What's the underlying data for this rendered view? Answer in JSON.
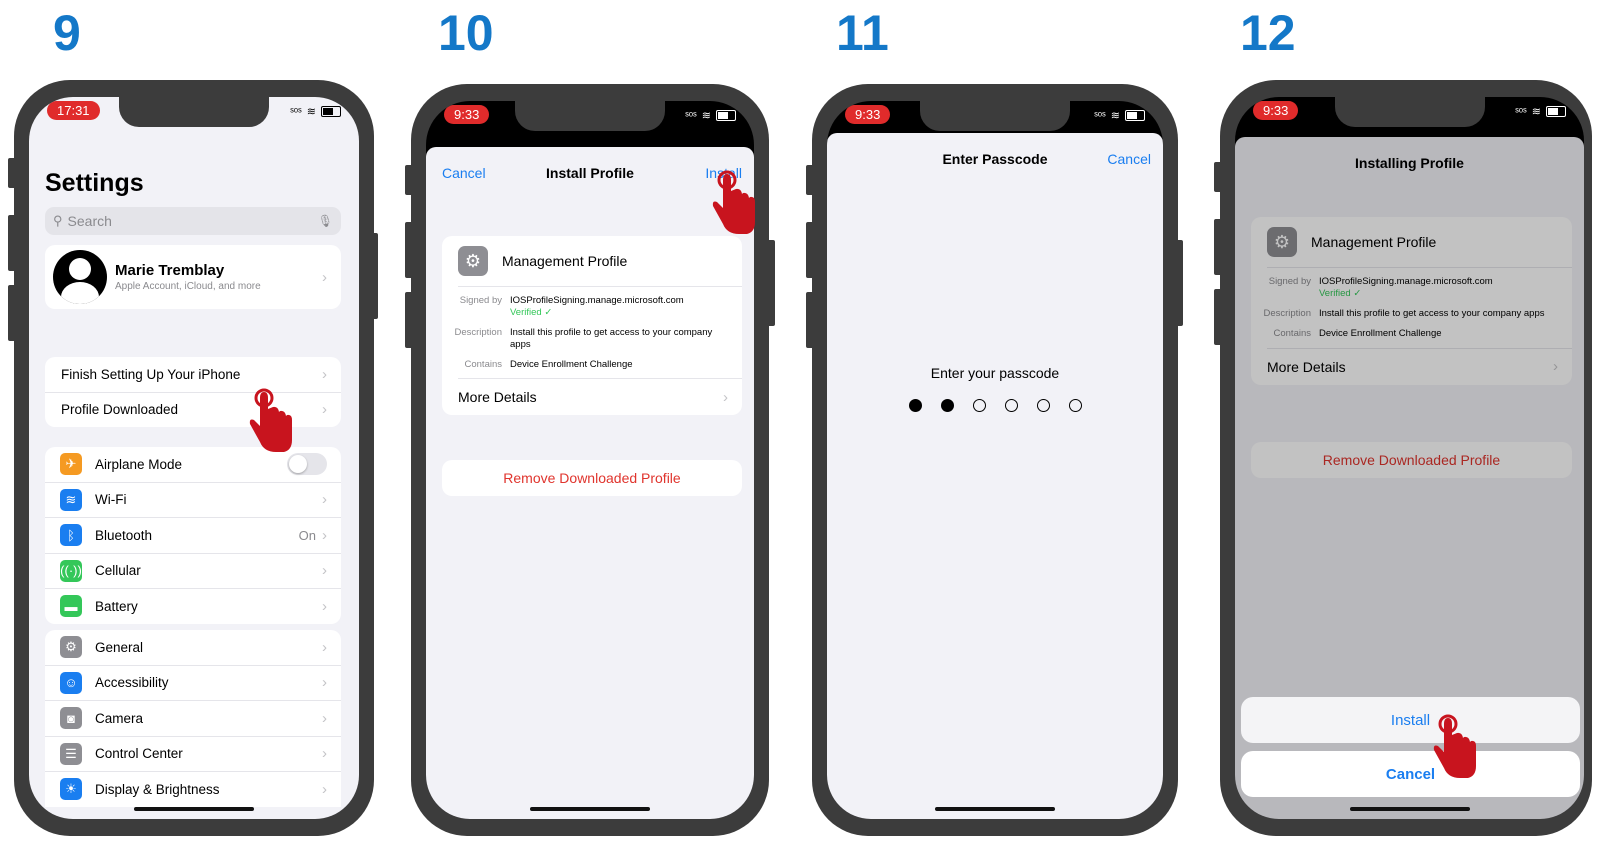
{
  "steps": [
    "9",
    "10",
    "11",
    "12"
  ],
  "accent_color": "#1478c8",
  "phone1": {
    "time": "17:31",
    "title": "Settings",
    "search_placeholder": "Search",
    "profile": {
      "name": "Marie Tremblay",
      "subtitle": "Apple Account, iCloud, and more"
    },
    "group1": [
      "Finish Setting Up Your iPhone",
      "Profile Downloaded"
    ],
    "group2": [
      {
        "label": "Airplane Mode",
        "icon": "airplane-icon",
        "color": "#f59a22"
      },
      {
        "label": "Wi-Fi",
        "icon": "wifi-icon",
        "color": "#1a7ef0"
      },
      {
        "label": "Bluetooth",
        "icon": "bluetooth-icon",
        "color": "#1a7ef0",
        "value": "On"
      },
      {
        "label": "Cellular",
        "icon": "cellular-icon",
        "color": "#34c759"
      },
      {
        "label": "Battery",
        "icon": "battery-icon",
        "color": "#34c759"
      }
    ],
    "group3": [
      {
        "label": "General",
        "icon": "gear-icon",
        "color": "#8e8e93"
      },
      {
        "label": "Accessibility",
        "icon": "accessibility-icon",
        "color": "#1a7ef0"
      },
      {
        "label": "Camera",
        "icon": "camera-icon",
        "color": "#8e8e93"
      },
      {
        "label": "Control Center",
        "icon": "control-center-icon",
        "color": "#8e8e93"
      },
      {
        "label": "Display & Brightness",
        "icon": "brightness-icon",
        "color": "#1a7ef0"
      }
    ]
  },
  "phone2": {
    "time": "9:33",
    "cancel": "Cancel",
    "title": "Install Profile",
    "install": "Install",
    "profile_name": "Management Profile",
    "signed_by_label": "Signed by",
    "signed_by": "IOSProfileSigning.manage.microsoft.com",
    "verified": "Verified ✓",
    "description_label": "Description",
    "description": "Install this profile to get access to your company apps",
    "contains_label": "Contains",
    "contains": "Device Enrollment Challenge",
    "more_details": "More Details",
    "remove": "Remove Downloaded Profile"
  },
  "phone3": {
    "time": "9:33",
    "title": "Enter Passcode",
    "cancel": "Cancel",
    "prompt": "Enter your passcode",
    "entered_digits": 2,
    "total_digits": 6
  },
  "phone4": {
    "time": "9:33",
    "title": "Installing Profile",
    "profile_name": "Management Profile",
    "signed_by_label": "Signed by",
    "signed_by": "IOSProfileSigning.manage.microsoft.com",
    "verified": "Verified ✓",
    "description_label": "Description",
    "description": "Install this profile to get access to your company apps",
    "contains_label": "Contains",
    "contains": "Device Enrollment Challenge",
    "more_details": "More Details",
    "remove": "Remove Downloaded Profile",
    "install": "Install",
    "cancel": "Cancel"
  }
}
